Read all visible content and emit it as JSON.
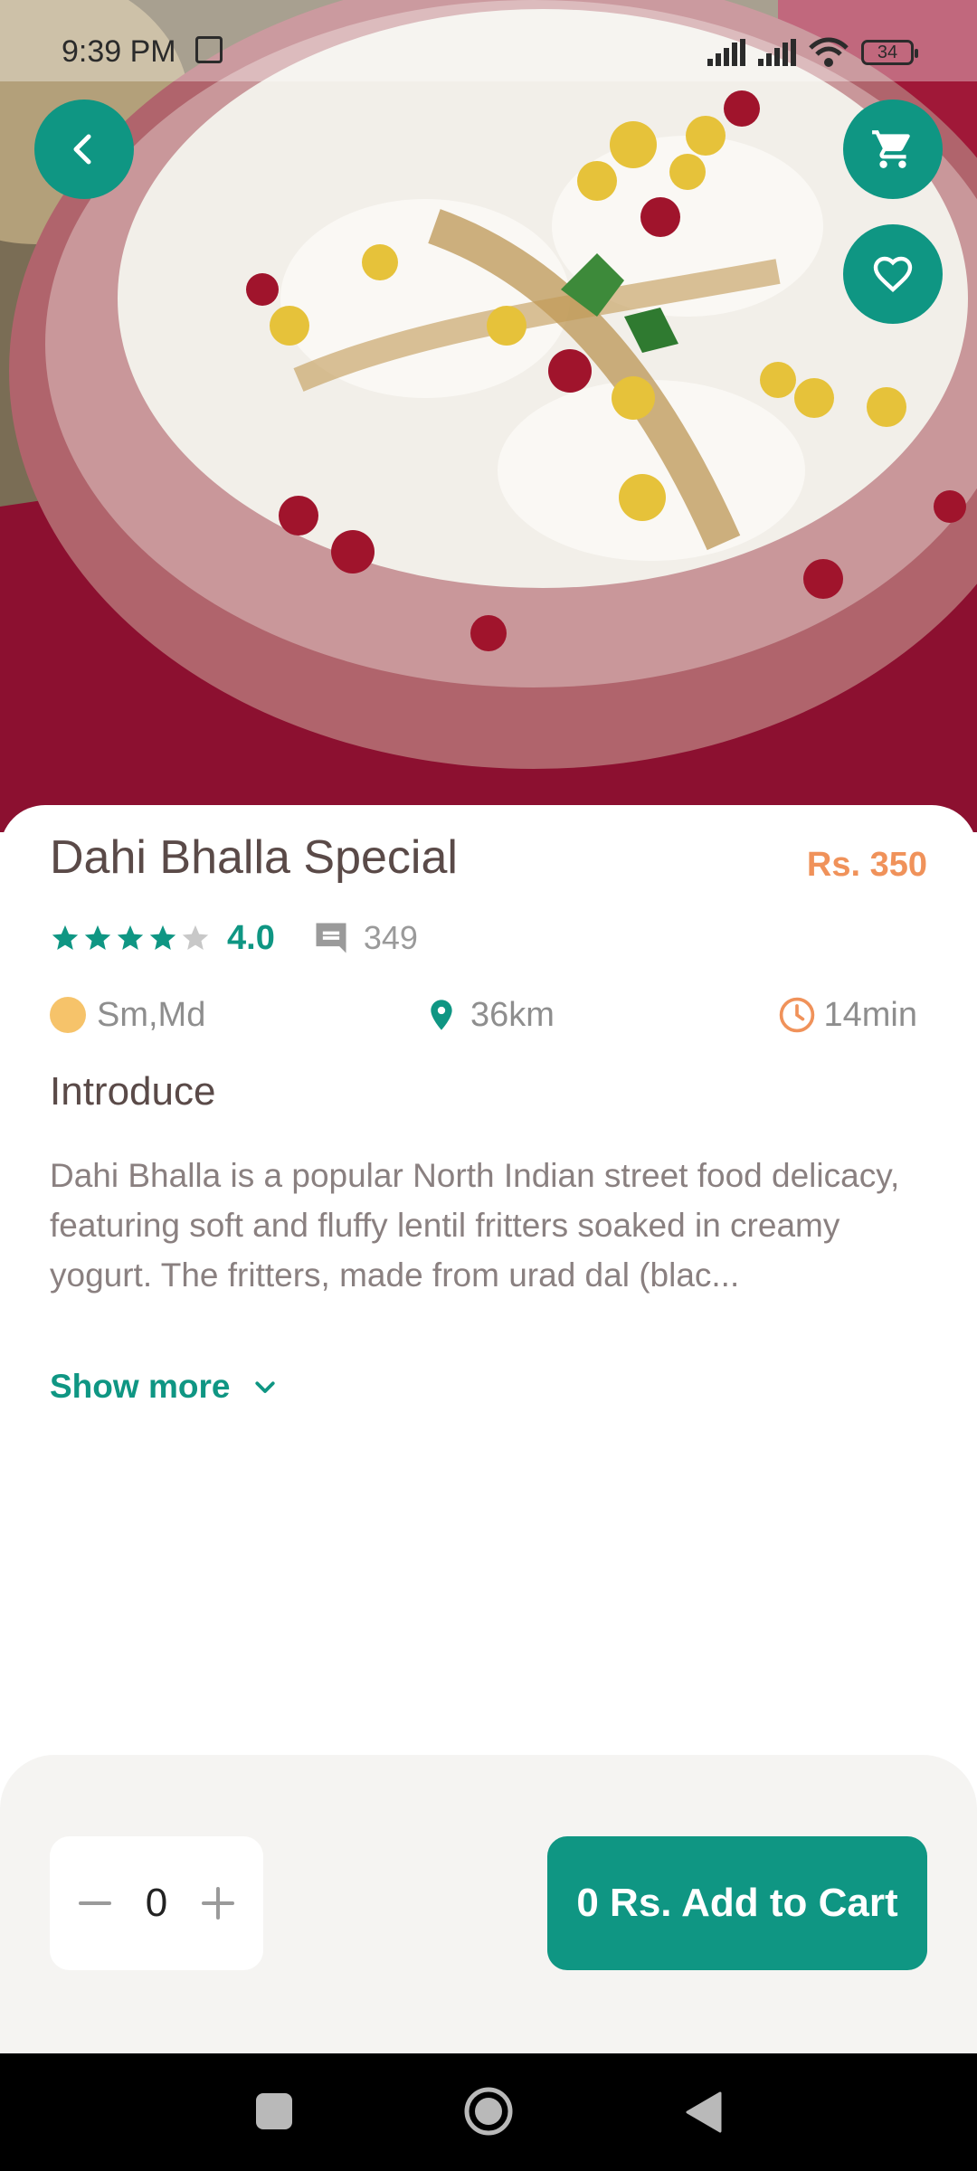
{
  "status_bar": {
    "time": "9:39 PM",
    "battery": "34"
  },
  "product": {
    "title": "Dahi Bhalla Special",
    "price": "Rs. 350",
    "rating": "4.0",
    "stars_filled": 4,
    "stars_total": 5,
    "reviews": "349",
    "size": "Sm,Md",
    "distance": "36km",
    "time": "14min"
  },
  "intro": {
    "heading": "Introduce",
    "text": "Dahi Bhalla is a popular North Indian street food delicacy, featuring soft and fluffy lentil fritters soaked in creamy yogurt. The fritters, made from urad dal (blac...",
    "show_more": "Show more"
  },
  "cart": {
    "quantity": "0",
    "add_button": "0 Rs. Add to Cart"
  },
  "colors": {
    "accent": "#0f9683",
    "price": "#f0925a",
    "title": "#5a4a48",
    "size_dot": "#f6c36a"
  },
  "icons": {
    "back": "chevron-left-icon",
    "cart": "shopping-cart-icon",
    "favorite": "heart-outline-icon",
    "reviews": "comment-icon",
    "distance": "location-pin-icon",
    "time": "clock-icon",
    "expand": "chevron-down-icon"
  }
}
